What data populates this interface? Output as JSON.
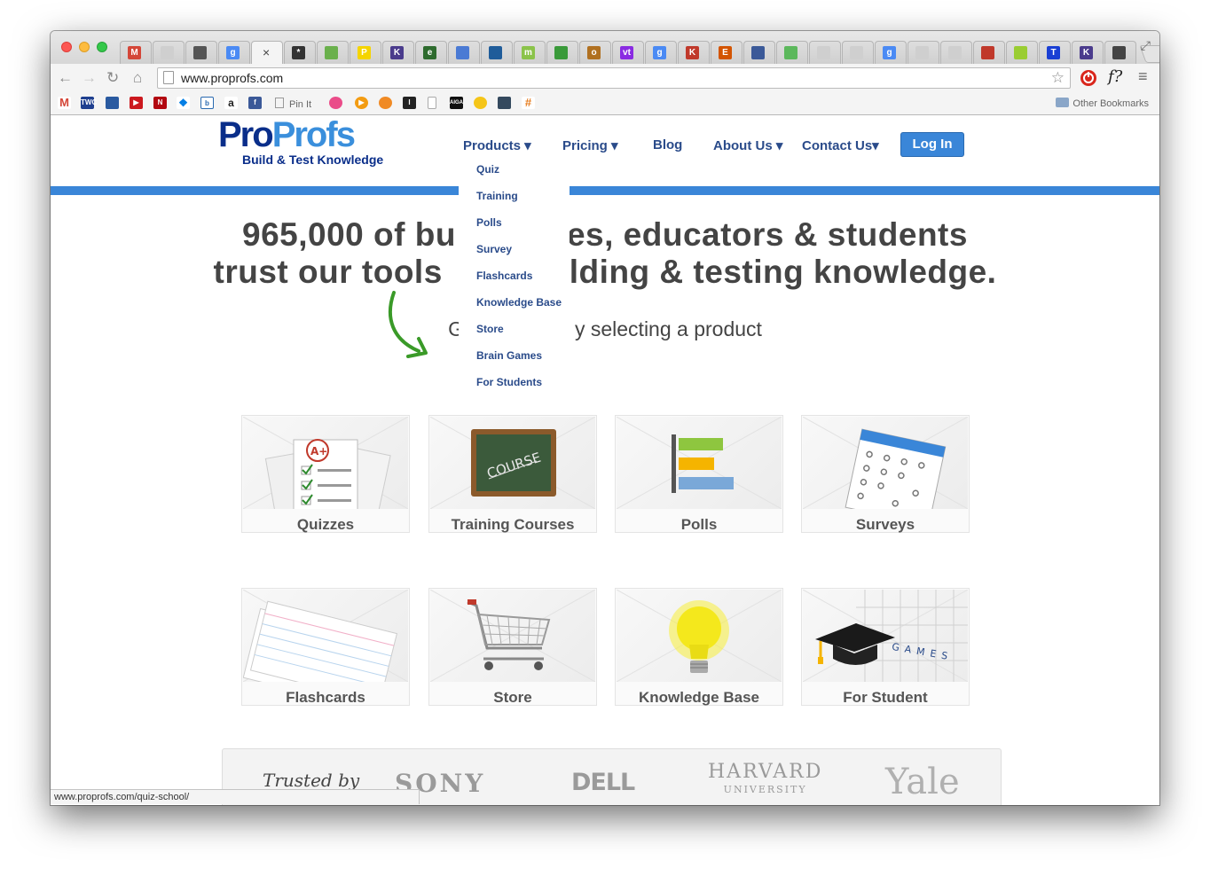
{
  "browser": {
    "url": "www.proprofs.com",
    "status_url": "www.proprofs.com/quiz-school/",
    "tab_close": "×",
    "bookmarks": {
      "pin_it": "Pin It",
      "other": "Other Bookmarks"
    },
    "tab_favicons": [
      {
        "icon": "gmail-icon",
        "color": "#d44638",
        "glyph": "M"
      },
      {
        "icon": "page-icon",
        "color": "#cfcfcf",
        "glyph": ""
      },
      {
        "icon": "apple-icon",
        "color": "#555555",
        "glyph": ""
      },
      {
        "icon": "google-icon",
        "color": "#4a8af4",
        "glyph": "g"
      },
      {
        "icon": "close-icon",
        "color": "#f4f4f4",
        "glyph": ""
      },
      {
        "icon": "snowflake-icon",
        "color": "#333333",
        "glyph": "*"
      },
      {
        "icon": "leaf-icon",
        "color": "#6ab04c",
        "glyph": ""
      },
      {
        "icon": "p-icon",
        "color": "#f5d400",
        "glyph": "P"
      },
      {
        "icon": "k-icon",
        "color": "#4a3b8c",
        "glyph": "K"
      },
      {
        "icon": "circle-green-icon",
        "color": "#2e6b2e",
        "glyph": "e"
      },
      {
        "icon": "doc-icon",
        "color": "#4a7ad4",
        "glyph": ""
      },
      {
        "icon": "wave-icon",
        "color": "#1f5c9a",
        "glyph": ""
      },
      {
        "icon": "me-icon",
        "color": "#8bc34a",
        "glyph": "m"
      },
      {
        "icon": "drop-icon",
        "color": "#3a9a3a",
        "glyph": ""
      },
      {
        "icon": "eye-icon",
        "color": "#b07020",
        "glyph": "o"
      },
      {
        "icon": "vt-icon",
        "color": "#8a2be2",
        "glyph": "vt"
      },
      {
        "icon": "google-icon",
        "color": "#4a8af4",
        "glyph": "g"
      },
      {
        "icon": "k12-icon",
        "color": "#c0392b",
        "glyph": "K"
      },
      {
        "icon": "ez-icon",
        "color": "#d35400",
        "glyph": "E"
      },
      {
        "icon": "grid-icon",
        "color": "#3b5998",
        "glyph": ""
      },
      {
        "icon": "tree-icon",
        "color": "#5cb85c",
        "glyph": ""
      },
      {
        "icon": "page-icon",
        "color": "#cfcfcf",
        "glyph": ""
      },
      {
        "icon": "page-icon",
        "color": "#cfcfcf",
        "glyph": ""
      },
      {
        "icon": "google-icon",
        "color": "#4a8af4",
        "glyph": "g"
      },
      {
        "icon": "page-icon",
        "color": "#cfcfcf",
        "glyph": ""
      },
      {
        "icon": "page-icon",
        "color": "#cfcfcf",
        "glyph": ""
      },
      {
        "icon": "apple-red-icon",
        "color": "#c0392b",
        "glyph": ""
      },
      {
        "icon": "check-green-icon",
        "color": "#9acd32",
        "glyph": ""
      },
      {
        "icon": "t-icon",
        "color": "#1a3fd4",
        "glyph": "T"
      },
      {
        "icon": "k-icon",
        "color": "#4a3b8c",
        "glyph": "K"
      },
      {
        "icon": "cube-icon",
        "color": "#444444",
        "glyph": ""
      }
    ]
  },
  "site": {
    "logo": {
      "part1": "Pro",
      "part2": "Profs",
      "tagline": "Build & Test Knowledge"
    },
    "nav": {
      "products": "Products ▾",
      "pricing": "Pricing ▾",
      "blog": "Blog",
      "about": "About Us ▾",
      "contact": "Contact Us▾",
      "login": "Log In"
    },
    "products_menu": [
      "Quiz",
      "Training",
      "Polls",
      "Survey",
      "Flashcards",
      "Knowledge Base",
      "Store",
      "Brain Games",
      "For Students"
    ],
    "headline_line1_left": "965,000 of bu",
    "headline_line1_right": "es, educators & students",
    "headline_line2_left": "trust our tools",
    "headline_line2_right": "lding & testing knowledge.",
    "subline_left": "G",
    "subline_right": "y selecting a product",
    "cards": [
      {
        "label": "Quizzes"
      },
      {
        "label": "Training Courses"
      },
      {
        "label": "Polls"
      },
      {
        "label": "Surveys"
      },
      {
        "label": "Flashcards"
      },
      {
        "label": "Store"
      },
      {
        "label": "Knowledge Base"
      },
      {
        "label": "For Student"
      }
    ],
    "course_board_text": "COURSE",
    "games_text": "GAMES",
    "trusted": {
      "label": "Trusted by",
      "logos": [
        "SONY",
        "DELL",
        "HARVARD",
        "UNIVERSITY",
        "Yale"
      ]
    }
  }
}
